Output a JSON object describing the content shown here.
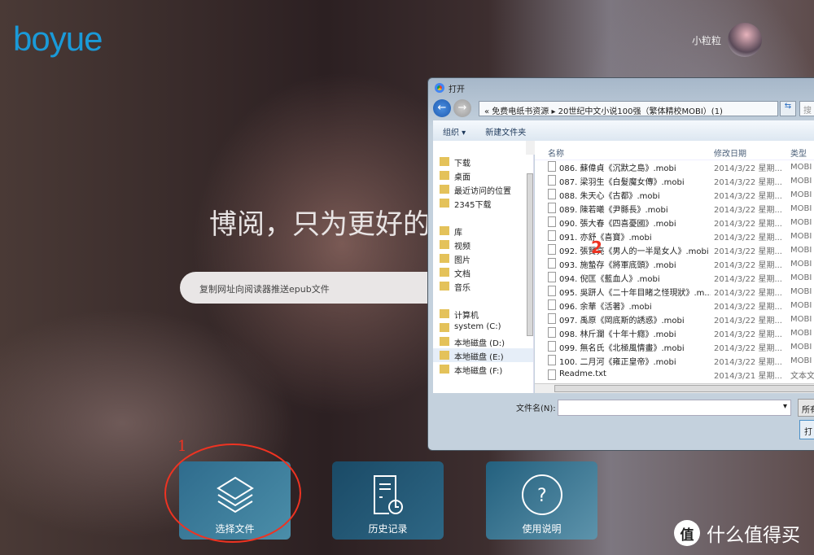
{
  "header": {
    "logo": "boyue",
    "username": "小粒粒"
  },
  "hero": {
    "slogan": "博阅，只为更好的",
    "search_placeholder": "复制网址向阅读器推送epub文件"
  },
  "tiles": [
    {
      "label": "选择文件",
      "icon": "layers-icon"
    },
    {
      "label": "历史记录",
      "icon": "history-icon"
    },
    {
      "label": "使用说明",
      "icon": "help-icon"
    }
  ],
  "annotations": {
    "one": "1",
    "two": "2",
    "annotation_color": "#e8332a"
  },
  "watermark": {
    "badge": "值",
    "text": "什么值得买"
  },
  "dialog": {
    "title": "打开",
    "path": "«  免费电纸书资源  ▸  20世纪中文小说100强（繁体精校MOBI）(1)",
    "search_placeholder": "搜",
    "toolbar": {
      "organize": "组织 ▾",
      "new_folder": "新建文件夹"
    },
    "nav": [
      "下载",
      "桌面",
      "最近访问的位置",
      "2345下载",
      "",
      "库",
      "视频",
      "图片",
      "文档",
      "音乐",
      "",
      "计算机",
      "system (C:)",
      "本地磁盘 (D:)",
      "本地磁盘 (E:)",
      "本地磁盘 (F:)"
    ],
    "columns": {
      "name": "名称",
      "date": "修改日期",
      "type": "类型"
    },
    "files": [
      {
        "name": "086. 蘇偉貞《沉默之島》.mobi",
        "date": "2014/3/22 星期...",
        "type": "MOBI"
      },
      {
        "name": "087. 梁羽生《白髮魔女傳》.mobi",
        "date": "2014/3/22 星期...",
        "type": "MOBI"
      },
      {
        "name": "088. 朱天心《古都》.mobi",
        "date": "2014/3/22 星期...",
        "type": "MOBI"
      },
      {
        "name": "089. 陳若曦《尹縣長》.mobi",
        "date": "2014/3/22 星期...",
        "type": "MOBI"
      },
      {
        "name": "090. 張大春《四喜憂國》.mobi",
        "date": "2014/3/22 星期...",
        "type": "MOBI"
      },
      {
        "name": "091. 亦舒《喜寶》.mobi",
        "date": "2014/3/22 星期...",
        "type": "MOBI"
      },
      {
        "name": "092. 張賢亮《男人的一半是女人》.mobi",
        "date": "2014/3/22 星期...",
        "type": "MOBI"
      },
      {
        "name": "093. 施蟄存《將軍底頭》.mobi",
        "date": "2014/3/22 星期...",
        "type": "MOBI"
      },
      {
        "name": "094. 倪匡《藍血人》.mobi",
        "date": "2014/3/22 星期...",
        "type": "MOBI"
      },
      {
        "name": "095. 吳趼人《二十年目睹之怪現狀》.m...",
        "date": "2014/3/22 星期...",
        "type": "MOBI"
      },
      {
        "name": "096. 余華《活著》.mobi",
        "date": "2014/3/22 星期...",
        "type": "MOBI"
      },
      {
        "name": "097. 禹原《岡底斯的誘惑》.mobi",
        "date": "2014/3/22 星期...",
        "type": "MOBI"
      },
      {
        "name": "098. 林斤瀾《十年十癮》.mobi",
        "date": "2014/3/22 星期...",
        "type": "MOBI"
      },
      {
        "name": "099. 無名氏《北極風情畫》.mobi",
        "date": "2014/3/22 星期...",
        "type": "MOBI"
      },
      {
        "name": "100. 二月河《雍正皇帝》.mobi",
        "date": "2014/3/22 星期...",
        "type": "MOBI"
      },
      {
        "name": "Readme.txt",
        "date": "2014/3/21 星期...",
        "type": "文本文"
      }
    ],
    "filename_label": "文件名(N):",
    "filename_value": "",
    "filter": "所有",
    "open_button": "打"
  }
}
